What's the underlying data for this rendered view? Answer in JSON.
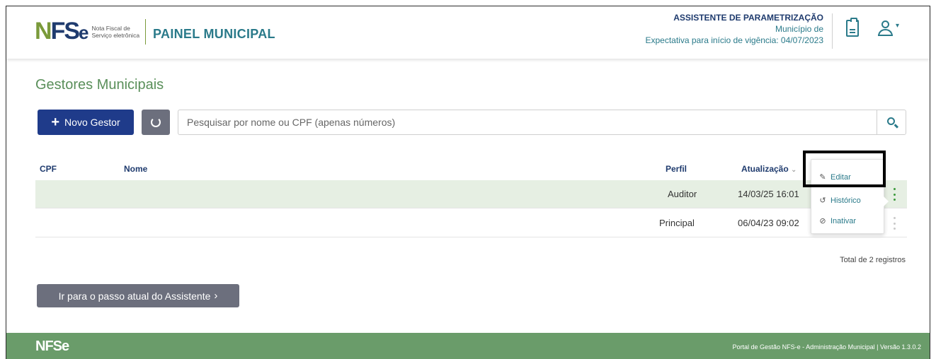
{
  "header": {
    "logo_main": "NFSe",
    "logo_sub_1": "Nota Fiscal de",
    "logo_sub_2": "Serviço eletrônica",
    "app_title": "PAINEL MUNICIPAL",
    "assistant_title": "ASSISTENTE DE PARAMETRIZAÇÃO",
    "municipio_label": "Município de",
    "vigencia_text": "Expectativa para início de vigência: 04/07/2023",
    "icons": [
      "badge-icon",
      "user-icon",
      "caret-down-icon"
    ]
  },
  "page": {
    "title": "Gestores Municipais",
    "new_button_label": "Novo Gestor",
    "search_placeholder": "Pesquisar por nome ou CPF (apenas números)"
  },
  "table": {
    "columns": {
      "cpf": "CPF",
      "nome": "Nome",
      "perfil": "Perfil",
      "atualizacao": "Atualização"
    },
    "rows": [
      {
        "cpf": "",
        "nome": "",
        "perfil": "Auditor",
        "atualizacao": "14/03/25 16:01",
        "selected": true
      },
      {
        "cpf": "",
        "nome": "",
        "perfil": "Principal",
        "atualizacao": "06/04/23 09:02",
        "selected": false
      }
    ],
    "total_text": "Total de 2 registros"
  },
  "dropdown": {
    "items": [
      {
        "label": "Editar",
        "icon": "pencil-icon"
      },
      {
        "label": "Histórico",
        "icon": "history-icon"
      },
      {
        "label": "Inativar",
        "icon": "block-icon"
      }
    ]
  },
  "assistant_button_label": "Ir para o passo atual do Assistente",
  "footer": {
    "logo": "NFSe",
    "text": "Portal de Gestão NFS-e - Administração Municipal | Versão 1.3.0.2"
  },
  "colors": {
    "primary": "#1f3b8a",
    "accent": "#2a7a8a",
    "footer": "#6a9c6a",
    "selected_row": "#e6efe3"
  }
}
